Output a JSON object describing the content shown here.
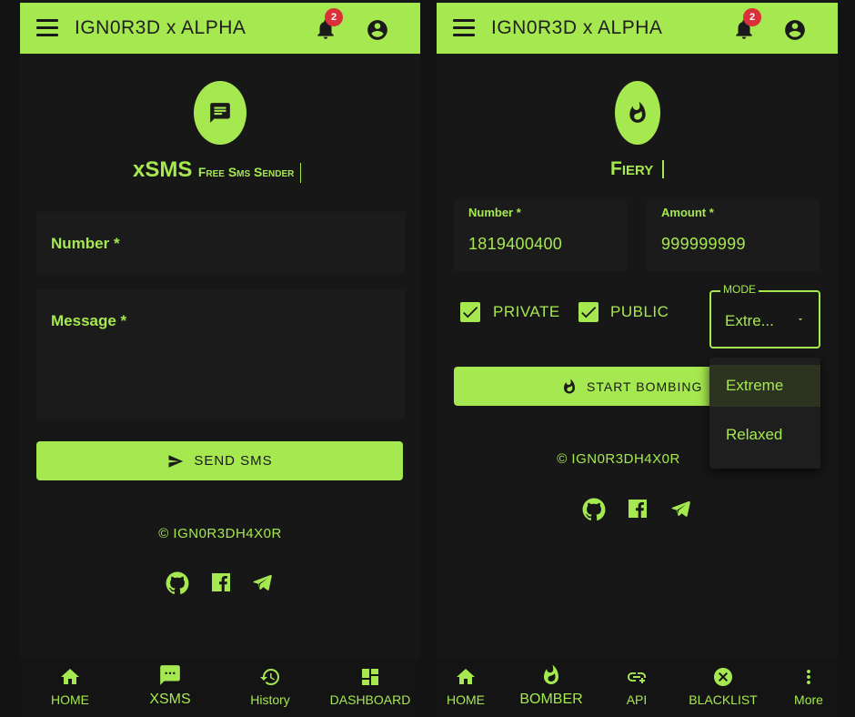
{
  "colors": {
    "accent": "#a6e84f",
    "background": "#171717",
    "badge": "#d9303a"
  },
  "app_title": "IGN0R3D x ALPHA",
  "notification_count": "2",
  "left": {
    "brand_main": "xSMS",
    "brand_sub": "Free Sms Sender",
    "number_label": "Number *",
    "message_label": "Message *",
    "send_button": "SEND SMS",
    "copyright": "© IGN0R3DH4X0R",
    "nav": [
      {
        "label": "HOME",
        "icon": "home-icon"
      },
      {
        "label": "XSMS",
        "icon": "sms-icon"
      },
      {
        "label": "History",
        "icon": "history-icon"
      },
      {
        "label": "DASHBOARD",
        "icon": "dashboard-icon"
      }
    ]
  },
  "right": {
    "brand_main": "Fiery",
    "number_label": "Number *",
    "number_value": "1819400400",
    "amount_label": "Amount *",
    "amount_value": "999999999",
    "private_label": "PRIVATE",
    "public_label": "PUBLIC",
    "mode_label": "MODE",
    "mode_value": "Extre...",
    "mode_options": [
      "Extreme",
      "Relaxed"
    ],
    "start_button": "START BOMBING",
    "copyright": "© IGN0R3DH4X0R",
    "nav": [
      {
        "label": "HOME",
        "icon": "home-icon"
      },
      {
        "label": "BOMBER",
        "icon": "fire-icon"
      },
      {
        "label": "API",
        "icon": "link-icon"
      },
      {
        "label": "BLACKLIST",
        "icon": "cancel-icon"
      },
      {
        "label": "More",
        "icon": "more-vert-icon"
      }
    ]
  }
}
